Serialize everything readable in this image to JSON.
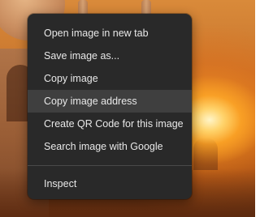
{
  "background": {
    "description_icon": "taj-mahal-sunset-photo"
  },
  "menu": {
    "items": [
      {
        "label": "Open image in new tab"
      },
      {
        "label": "Save image as..."
      },
      {
        "label": "Copy image"
      },
      {
        "label": "Copy image address"
      },
      {
        "label": "Create QR Code for this image"
      },
      {
        "label": "Search image with Google"
      }
    ],
    "inspect_label": "Inspect",
    "highlighted_item": "Copy image address"
  },
  "colors": {
    "menu_bg": "#292929",
    "menu_text": "#e8e8e8",
    "hover_bg": "#3f3f3f",
    "separator": "#4a4a4a"
  }
}
